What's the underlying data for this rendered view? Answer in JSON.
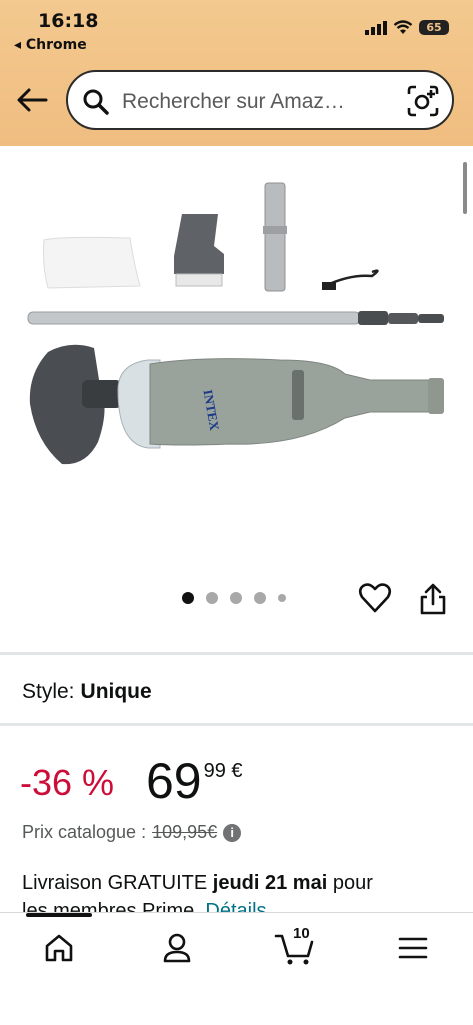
{
  "status": {
    "time": "16:18",
    "back_app": "◂ Chrome",
    "battery": "65"
  },
  "search": {
    "placeholder": "Rechercher sur Amaz…"
  },
  "product_image": {
    "brand_mark": "INTEX"
  },
  "carousel": {
    "dots": 5,
    "active_index": 0
  },
  "style": {
    "label": "Style:",
    "value": "Unique"
  },
  "price": {
    "discount": "-36 %",
    "whole": "69",
    "fraction": "99 €",
    "list_label": "Prix catalogue :",
    "list_value": "109,95€"
  },
  "delivery": {
    "prefix": "Livraison GRATUITE ",
    "date": "jeudi 21 mai",
    "suffix": " pour",
    "line2": "les membres Prime. ",
    "details_link": "Détails"
  },
  "tabbar": {
    "cart_count": "10"
  },
  "icons": [
    "back-arrow-icon",
    "search-icon",
    "camera-icon",
    "heart-icon",
    "share-icon",
    "home-icon",
    "account-icon",
    "cart-icon",
    "menu-icon",
    "info-icon"
  ]
}
